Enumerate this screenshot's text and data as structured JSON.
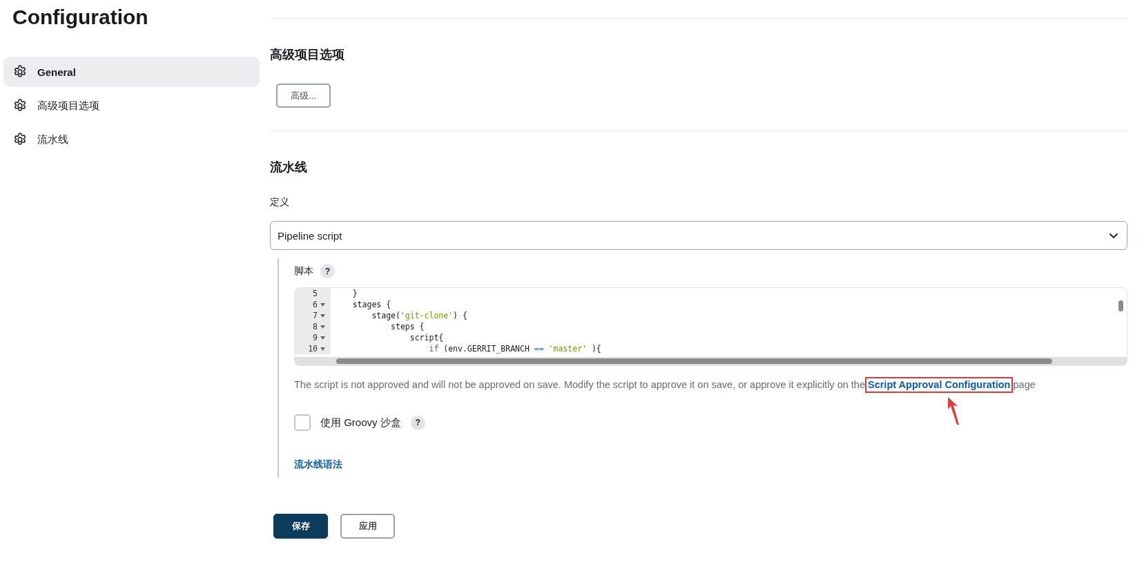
{
  "page_title": "Configuration",
  "sidebar": {
    "items": [
      {
        "label": "General",
        "selected": true
      },
      {
        "label": "高级项目选项",
        "selected": false
      },
      {
        "label": "流水线",
        "selected": false
      }
    ]
  },
  "advanced_section": {
    "heading": "高级项目选项",
    "button": "高级..."
  },
  "pipeline_section": {
    "heading": "流水线",
    "definition_label": "定义",
    "definition_value": "Pipeline script",
    "script_label": "脚本",
    "help": "?",
    "editor": {
      "lines": [
        {
          "number": "5",
          "foldable": false,
          "tokens": [
            {
              "kind": "plain",
              "text": "    }"
            }
          ]
        },
        {
          "number": "6",
          "foldable": true,
          "tokens": [
            {
              "kind": "plain",
              "text": "    stages {"
            }
          ]
        },
        {
          "number": "7",
          "foldable": true,
          "tokens": [
            {
              "kind": "plain",
              "text": "        stage("
            },
            {
              "kind": "string",
              "text": "'git-clone'"
            },
            {
              "kind": "plain",
              "text": ") {"
            }
          ]
        },
        {
          "number": "8",
          "foldable": true,
          "tokens": [
            {
              "kind": "plain",
              "text": "            steps {"
            }
          ]
        },
        {
          "number": "9",
          "foldable": true,
          "tokens": [
            {
              "kind": "plain",
              "text": "                script{"
            }
          ]
        },
        {
          "number": "10",
          "foldable": true,
          "tokens": [
            {
              "kind": "keyword",
              "text": "                    if"
            },
            {
              "kind": "plain",
              "text": " (env.GERRIT_BRANCH "
            },
            {
              "kind": "operator",
              "text": "=="
            },
            {
              "kind": "string",
              "text": " 'master'"
            },
            {
              "kind": "plain",
              "text": " ){"
            }
          ]
        }
      ]
    },
    "approval_note": {
      "before": "The script is not approved and will not be approved on save. Modify the script to approve it on save, or approve it explicitly on the",
      "link": "Script Approval Configuration",
      "after": "page"
    },
    "sandbox": {
      "label": "使用 Groovy 沙盒",
      "checked": false,
      "help": "?"
    },
    "syntax_link": "流水线语法"
  },
  "actions": [
    {
      "label": "保存",
      "kind": "primary"
    },
    {
      "label": "应用",
      "kind": "secondary"
    }
  ]
}
